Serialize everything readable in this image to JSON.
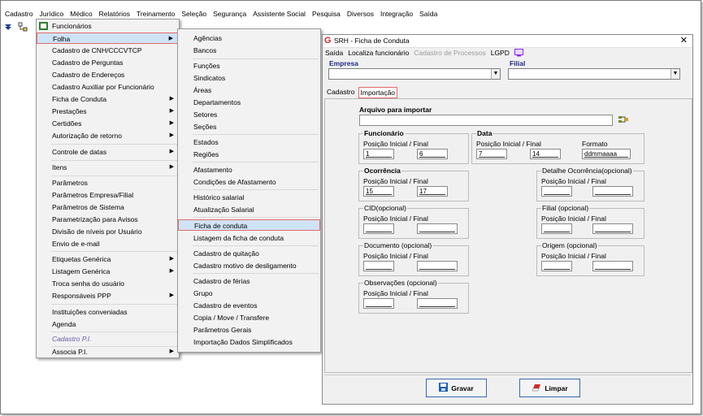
{
  "menubar": [
    "Cadastro",
    "Jurídico",
    "Médico",
    "Relatórios",
    "Treinamento",
    "Seleção",
    "Segurança",
    "Assistente Social",
    "Pesquisa",
    "Diversos",
    "Integração",
    "Saída"
  ],
  "menu1": {
    "items": [
      "Funcionários",
      "Folha",
      "Cadastro de CNH/CCCVTCP",
      "Cadastro de Perguntas",
      "Cadastro de Endereços",
      "Cadastro Auxiliar por Funcionário",
      "Ficha de Conduta",
      "Prestações",
      "Certidões",
      "Autorização de retorno",
      "Controle de datas",
      "Itens",
      "Parâmetros",
      "Parâmetros Empresa/Filial",
      "Parâmetros de Sistema",
      "Parametrização para Avisos",
      "Divisão de níveis por Usuário",
      "Envio de e-mail",
      "Etiquetas Genérica",
      "Listagem Genérica",
      "Troca senha do usuário",
      "Responsáveis PPP",
      "Instituições conveniadas",
      "Agenda",
      "Cadastro P.I.",
      "Associa P.I."
    ]
  },
  "menu2": {
    "items": [
      "Agências",
      "Bancos",
      "Funções",
      "Sindicatos",
      "Áreas",
      "Departamentos",
      "Setores",
      "Seções",
      "Estados",
      "Regiões",
      "Afastamento",
      "Condições de Afastamento",
      "Histórico salarial",
      "Atualização Salarial",
      "Ficha de conduta",
      "Listagem da ficha de conduta",
      "Cadastro de quitação",
      "Cadastro motivo de desligamento",
      "Cadastro de férias",
      "Grupo",
      "Cadastro de eventos",
      "Copia / Move / Transfere",
      "Parâmetros Gerais",
      "Importação Dados Simplificados"
    ]
  },
  "window": {
    "title": "SRH - Ficha de Conduta",
    "menu": [
      "Saída",
      "Localiza funcionário",
      "Cadastro de Processos",
      "LGPD"
    ],
    "empresa_label": "Empresa",
    "filial_label": "Filial",
    "tabs": [
      "Cadastro",
      "Importação"
    ],
    "arquivo_label": "Arquivo para importar",
    "sub_label": "Posição Inicial / Final",
    "groups": {
      "funcionario": {
        "title": "Funcionário",
        "ini": "1",
        "fim": "6"
      },
      "data": {
        "title": "Data",
        "ini": "7",
        "fim": "14",
        "formato_label": "Formato",
        "formato": "ddmmaaaa"
      },
      "ocorrencia": {
        "title": "Ocorrência",
        "ini": "15",
        "fim": "17"
      },
      "detalhe": {
        "title": "Detalhe Ocorrência(opcional)"
      },
      "cid": {
        "title": "CID(opcional)"
      },
      "filial": {
        "title": "Filial (opcional)"
      },
      "documento": {
        "title": "Documento (opcional)"
      },
      "origem": {
        "title": "Origem (opcional)"
      },
      "observacoes": {
        "title": "Observações (opcional)"
      }
    },
    "buttons": {
      "gravar": "Gravar",
      "limpar": "Limpar"
    }
  },
  "colors": {
    "highlight": "#cfe3f7",
    "highlight_border": "#e26a6a",
    "label_blue": "#1f2a8a",
    "arrow": "#d62828"
  }
}
